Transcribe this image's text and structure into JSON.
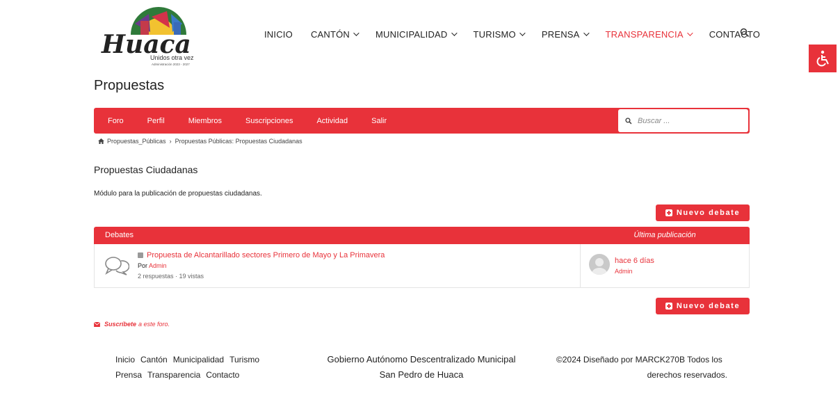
{
  "logo": {
    "name": "Huaca",
    "tagline": "Unidos otra vez",
    "sub": "Administración 2023 - 2027"
  },
  "nav": {
    "items": [
      {
        "label": "INICIO",
        "dropdown": false
      },
      {
        "label": "CANTÓN",
        "dropdown": true
      },
      {
        "label": "MUNICIPALIDAD",
        "dropdown": true
      },
      {
        "label": "TURISMO",
        "dropdown": true
      },
      {
        "label": "PRENSA",
        "dropdown": true
      },
      {
        "label": "TRANSPARENCIA",
        "dropdown": true,
        "active": true
      },
      {
        "label": "CONTACTO",
        "dropdown": false
      }
    ]
  },
  "page": {
    "title": "Propuestas"
  },
  "forum_menu": {
    "items": [
      "Foro",
      "Perfil",
      "Miembros",
      "Suscripciones",
      "Actividad",
      "Salir"
    ],
    "search_placeholder": "Buscar ..."
  },
  "breadcrumb": {
    "home": "Propuestas_Públicas",
    "current": "Propuestas Públicas: Propuestas Ciudadanas"
  },
  "forum": {
    "title": "Propuestas Ciudadanas",
    "description": "Módulo para la publicación de propuestas ciudadanas.",
    "new_topic_label": "Nuevo debate"
  },
  "table": {
    "col_topics": "Debates",
    "col_last": "Última publicación",
    "rows": [
      {
        "title": "Propuesta de Alcantarillado sectores Primero de Mayo y La Primavera",
        "by_label": "Por",
        "author": "Admin",
        "stats": "2 respuestas · 19 vistas",
        "last_time": "hace 6 días",
        "last_user": "Admin"
      }
    ]
  },
  "subscribe": {
    "link": "Suscríbete",
    "rest": "a este foro."
  },
  "footer": {
    "links_row1": [
      "Inicio",
      "Cantón",
      "Municipalidad",
      "Turismo"
    ],
    "links_row2": [
      "Prensa",
      "Transparencia",
      "Contacto"
    ],
    "center_line1": "Gobierno Autónomo Descentralizado Municipal",
    "center_line2": "San Pedro de Huaca",
    "right_line1": "©2024 Diseñado por MARCK270B Todos los",
    "right_line2": "derechos reservados."
  },
  "colors": {
    "accent": "#e8323a"
  }
}
